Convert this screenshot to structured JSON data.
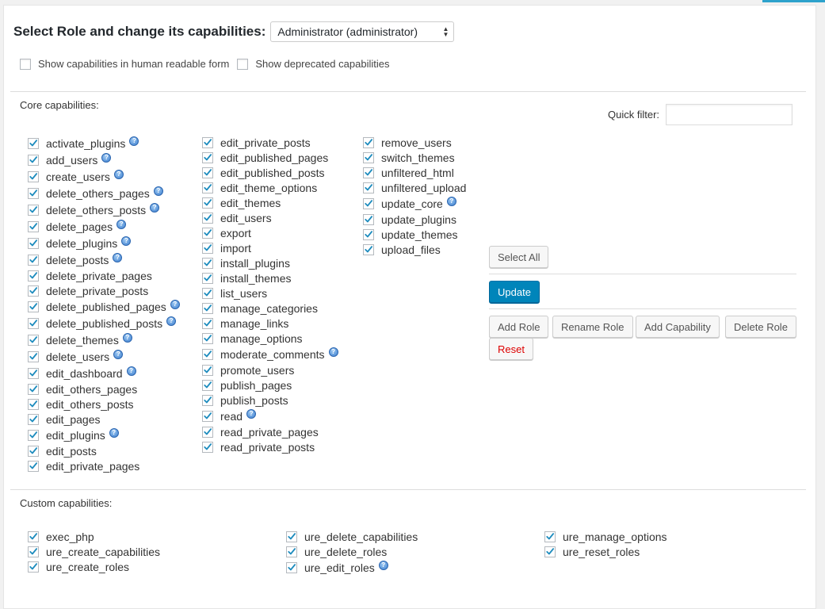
{
  "header": {
    "title": "Select Role and change its capabilities:",
    "role_selected": "Administrator (administrator)"
  },
  "options": {
    "human_readable": "Show capabilities in human readable form",
    "deprecated": "Show deprecated capabilities"
  },
  "core": {
    "label": "Core capabilities:",
    "quick_filter_label": "Quick filter:",
    "columns": [
      [
        {
          "name": "activate_plugins",
          "help": true
        },
        {
          "name": "add_users",
          "help": true
        },
        {
          "name": "create_users",
          "help": true
        },
        {
          "name": "delete_others_pages",
          "help": true
        },
        {
          "name": "delete_others_posts",
          "help": true
        },
        {
          "name": "delete_pages",
          "help": true
        },
        {
          "name": "delete_plugins",
          "help": true
        },
        {
          "name": "delete_posts",
          "help": true
        },
        {
          "name": "delete_private_pages",
          "help": false
        },
        {
          "name": "delete_private_posts",
          "help": false
        },
        {
          "name": "delete_published_pages",
          "help": true
        },
        {
          "name": "delete_published_posts",
          "help": true
        },
        {
          "name": "delete_themes",
          "help": true
        },
        {
          "name": "delete_users",
          "help": true
        },
        {
          "name": "edit_dashboard",
          "help": true
        },
        {
          "name": "edit_others_pages",
          "help": false
        },
        {
          "name": "edit_others_posts",
          "help": false
        },
        {
          "name": "edit_pages",
          "help": false
        },
        {
          "name": "edit_plugins",
          "help": true
        },
        {
          "name": "edit_posts",
          "help": false
        },
        {
          "name": "edit_private_pages",
          "help": false
        }
      ],
      [
        {
          "name": "edit_private_posts",
          "help": false
        },
        {
          "name": "edit_published_pages",
          "help": false
        },
        {
          "name": "edit_published_posts",
          "help": false
        },
        {
          "name": "edit_theme_options",
          "help": false
        },
        {
          "name": "edit_themes",
          "help": false
        },
        {
          "name": "edit_users",
          "help": false
        },
        {
          "name": "export",
          "help": false
        },
        {
          "name": "import",
          "help": false
        },
        {
          "name": "install_plugins",
          "help": false
        },
        {
          "name": "install_themes",
          "help": false
        },
        {
          "name": "list_users",
          "help": false
        },
        {
          "name": "manage_categories",
          "help": false
        },
        {
          "name": "manage_links",
          "help": false
        },
        {
          "name": "manage_options",
          "help": false
        },
        {
          "name": "moderate_comments",
          "help": true
        },
        {
          "name": "promote_users",
          "help": false
        },
        {
          "name": "publish_pages",
          "help": false
        },
        {
          "name": "publish_posts",
          "help": false
        },
        {
          "name": "read",
          "help": true
        },
        {
          "name": "read_private_pages",
          "help": false
        },
        {
          "name": "read_private_posts",
          "help": false
        }
      ],
      [
        {
          "name": "remove_users",
          "help": false
        },
        {
          "name": "switch_themes",
          "help": false
        },
        {
          "name": "unfiltered_html",
          "help": false
        },
        {
          "name": "unfiltered_upload",
          "help": false
        },
        {
          "name": "update_core",
          "help": true
        },
        {
          "name": "update_plugins",
          "help": false
        },
        {
          "name": "update_themes",
          "help": false
        },
        {
          "name": "upload_files",
          "help": false
        }
      ]
    ]
  },
  "custom": {
    "label": "Custom capabilities:",
    "columns": [
      [
        {
          "name": "exec_php",
          "help": false
        },
        {
          "name": "ure_create_capabilities",
          "help": false
        },
        {
          "name": "ure_create_roles",
          "help": false
        }
      ],
      [
        {
          "name": "ure_delete_capabilities",
          "help": false
        },
        {
          "name": "ure_delete_roles",
          "help": false
        },
        {
          "name": "ure_edit_roles",
          "help": true
        }
      ],
      [
        {
          "name": "ure_manage_options",
          "help": false
        },
        {
          "name": "ure_reset_roles",
          "help": false
        }
      ]
    ]
  },
  "actions": {
    "select_all": "Select All",
    "update": "Update",
    "add_role": "Add Role",
    "rename_role": "Rename Role",
    "add_capability": "Add Capability",
    "delete_role": "Delete Role",
    "reset": "Reset"
  },
  "icons": {
    "check": "checkmark-icon",
    "help": "help-icon",
    "select_arrows": "select-arrows-icon"
  },
  "colors": {
    "primary": "#0085ba",
    "danger": "#dd0000",
    "check": "#1e8cbe"
  }
}
